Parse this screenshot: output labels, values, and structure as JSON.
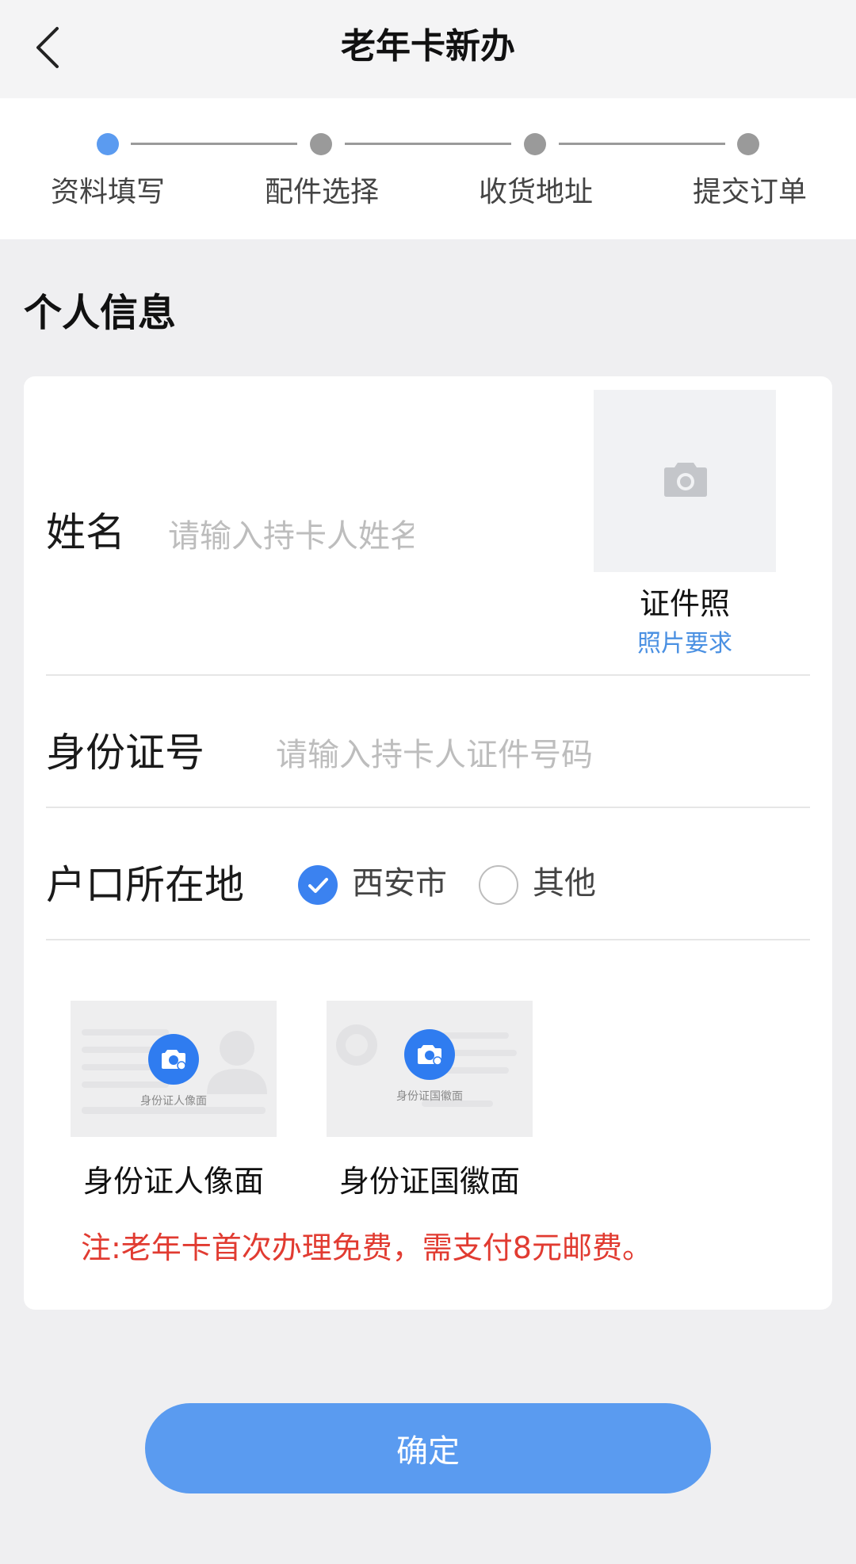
{
  "header": {
    "title": "老年卡新办"
  },
  "steps": [
    {
      "label": "资料填写",
      "active": true
    },
    {
      "label": "配件选择",
      "active": false
    },
    {
      "label": "收货地址",
      "active": false
    },
    {
      "label": "提交订单",
      "active": false
    }
  ],
  "section": {
    "title": "个人信息"
  },
  "form": {
    "name": {
      "label": "姓名",
      "placeholder": "请输入持卡人姓名",
      "value": ""
    },
    "photo": {
      "caption": "证件照",
      "requirements_link": "照片要求"
    },
    "id_number": {
      "label": "身份证号",
      "placeholder": "请输入持卡人证件号码",
      "value": ""
    },
    "residence": {
      "label": "户口所在地",
      "options": [
        {
          "label": "西安市",
          "checked": true
        },
        {
          "label": "其他",
          "checked": false
        }
      ]
    },
    "id_front": {
      "caption": "身份证人像面",
      "thumb_text": "身份证人像面"
    },
    "id_back": {
      "caption": "身份证国徽面",
      "thumb_text": "身份证国徽面"
    },
    "note": "注:老年卡首次办理免费，需支付8元邮费。"
  },
  "actions": {
    "confirm_label": "确定"
  },
  "colors": {
    "accent": "#5a9bf0",
    "link": "#4a90e2",
    "warning": "#e13b31",
    "background": "#efeff1"
  }
}
